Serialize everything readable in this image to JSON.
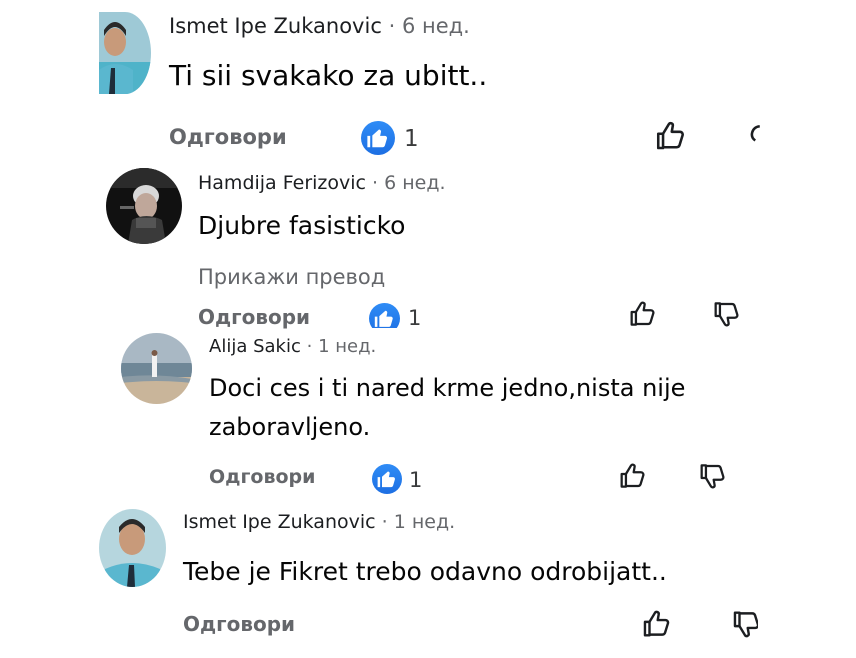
{
  "comments": [
    {
      "author": "Ismet Ipe Zukanovic",
      "separator": "·",
      "time": "6 нед.",
      "text": "Ti sii svakako za ubitt..",
      "reply_label": "Одговори",
      "like_count": "1",
      "avatar": "man-portrait"
    },
    {
      "author": "Hamdija Ferizovic",
      "separator": "·",
      "time": "6 нед.",
      "text": "Djubre fasisticko",
      "translate_label": "Прикажи превод",
      "reply_label": "Одговори",
      "like_count": "1",
      "avatar": "performer-portrait"
    },
    {
      "author": "Alija Sakic",
      "separator": "·",
      "time": "1 нед.",
      "text_line1": "Doci ces i ti nared krme jedno,nista nije",
      "text_line2": "zaboravljeno.",
      "reply_label": "Одговори",
      "like_count": "1",
      "avatar": "beach-figure"
    },
    {
      "author": "Ismet Ipe Zukanovic",
      "separator": "·",
      "time": "1 нед.",
      "text": "Tebe je Fikret trebo odavno odrobijatt..",
      "reply_label": "Одговори",
      "avatar": "man-portrait"
    }
  ],
  "colors": {
    "like_blue": "#1d6fe3",
    "meta_gray": "#65676b",
    "text": "#050505"
  }
}
